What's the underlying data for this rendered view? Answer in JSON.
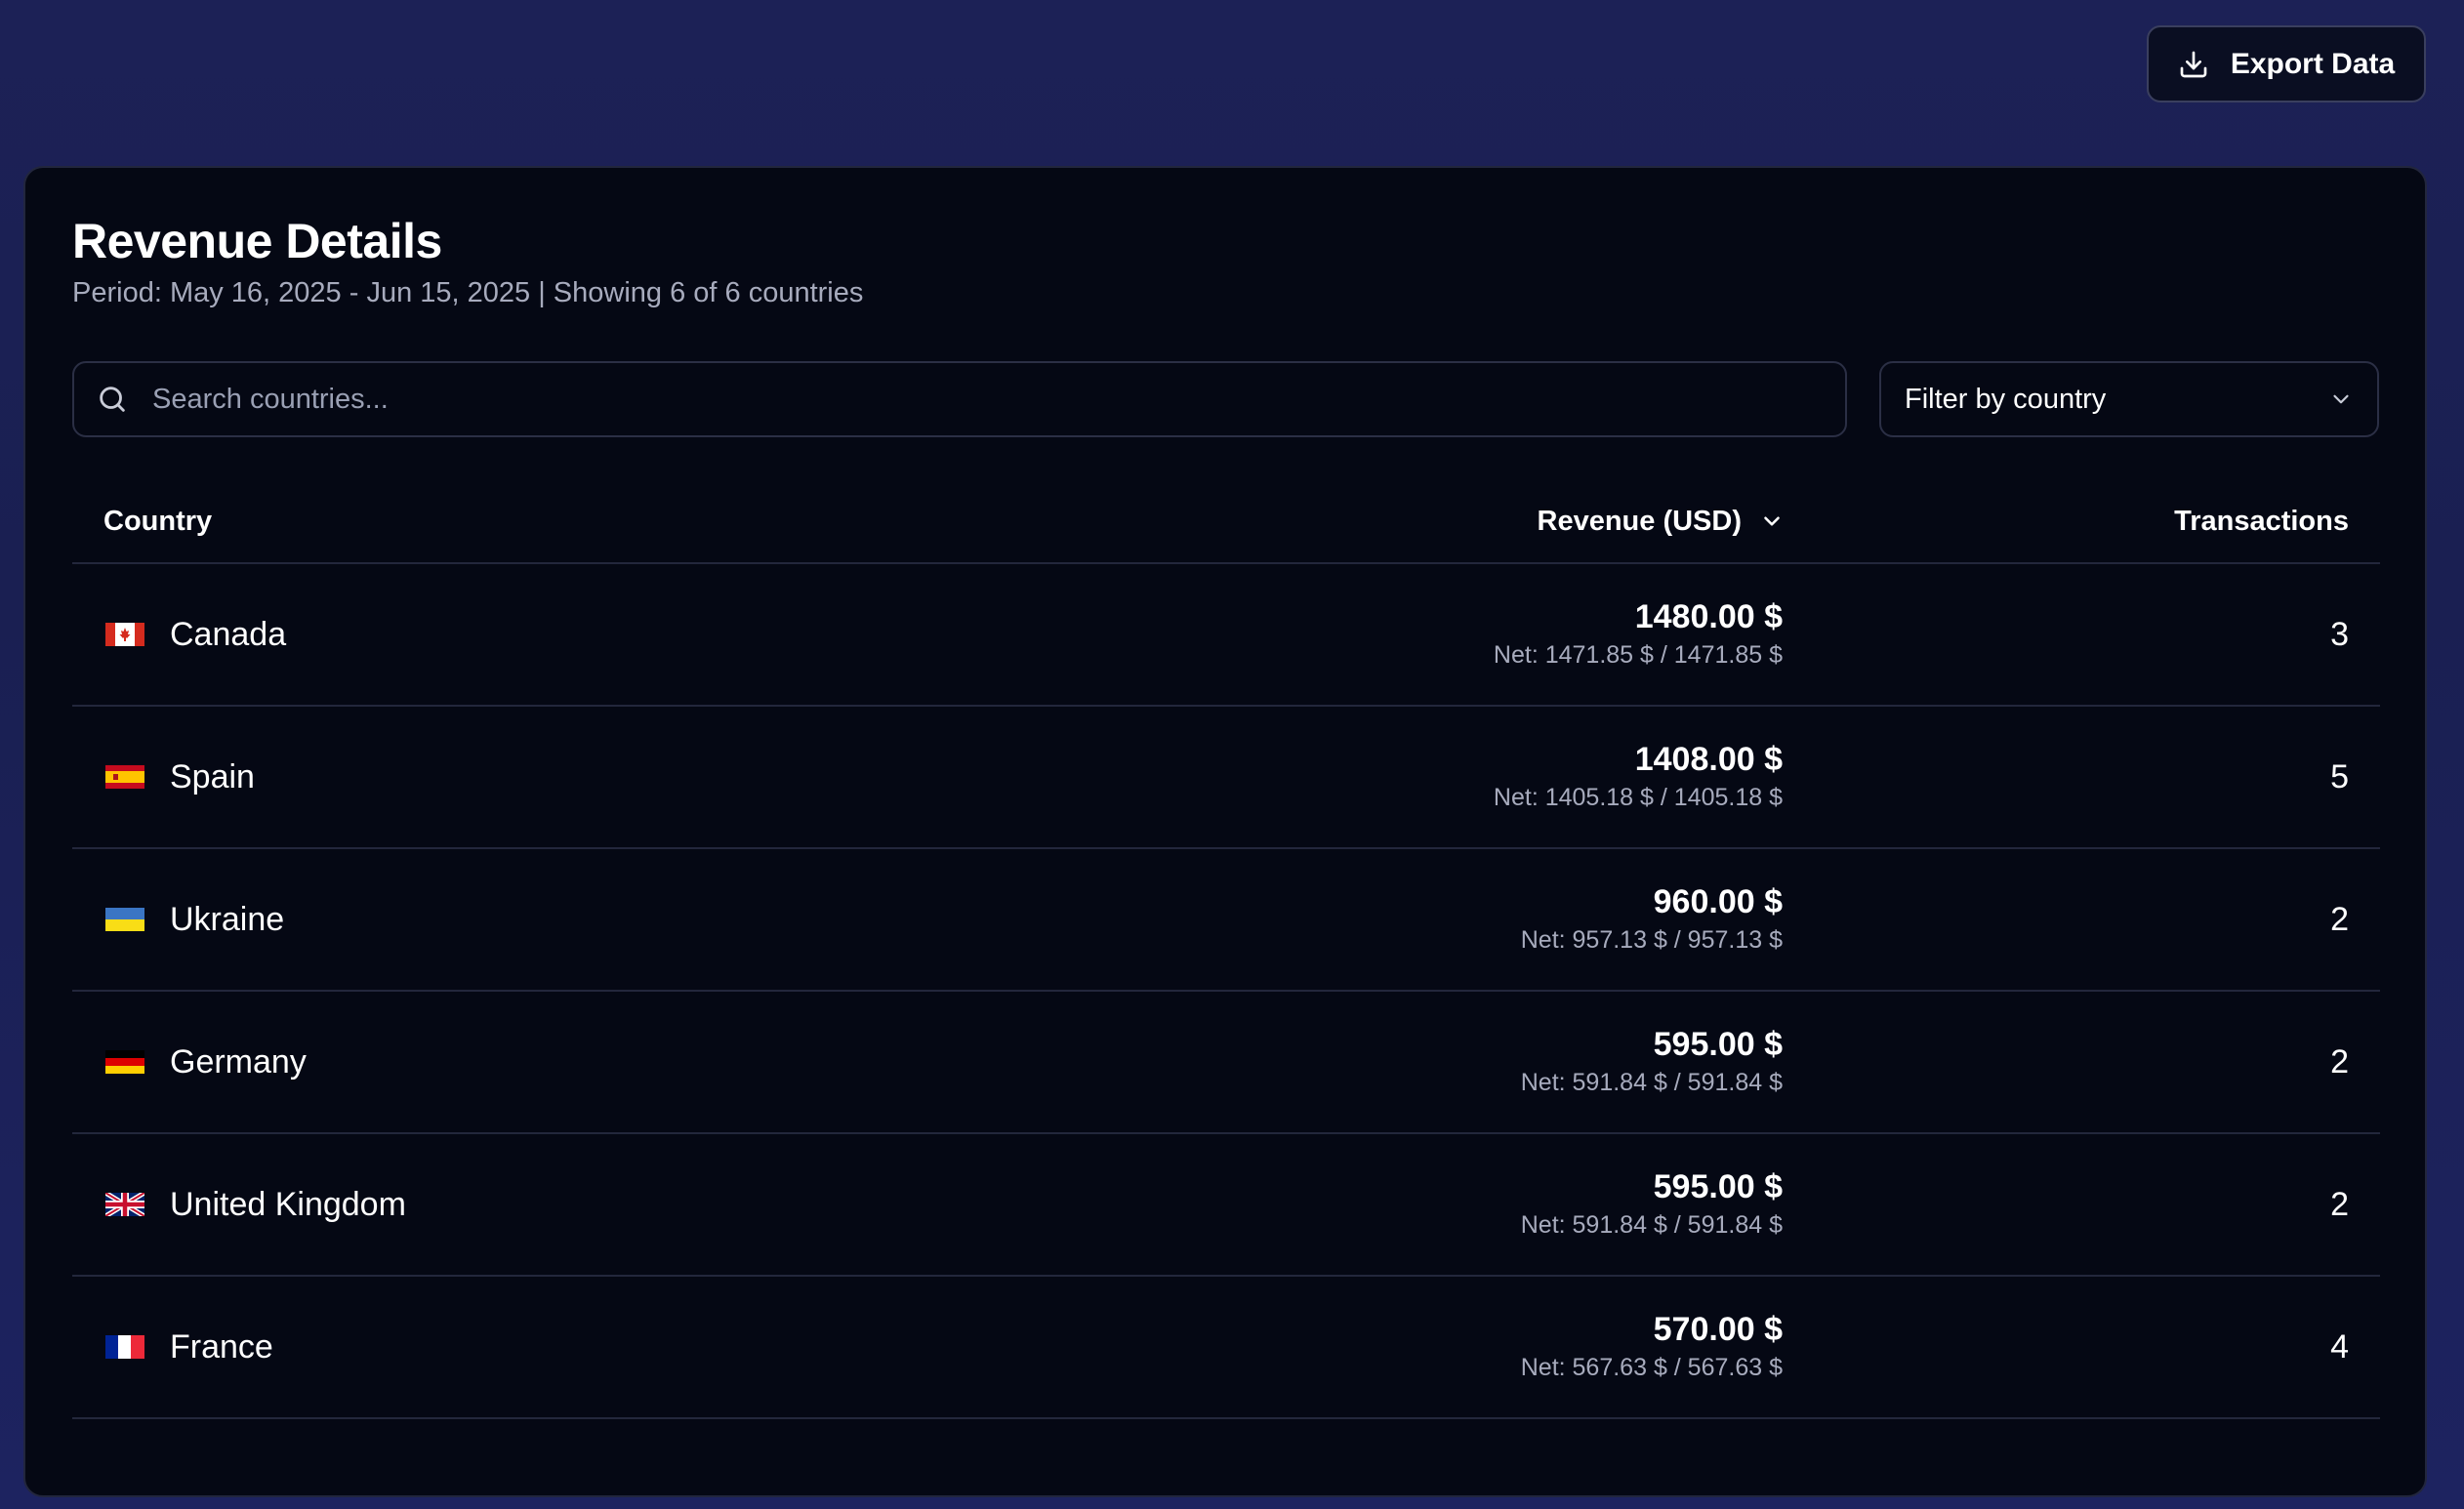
{
  "header": {
    "export_label": "Export Data"
  },
  "card": {
    "title": "Revenue Details",
    "subtitle": "Period: May 16, 2025 - Jun 15, 2025 | Showing 6 of 6 countries"
  },
  "search": {
    "placeholder": "Search countries..."
  },
  "filter": {
    "label": "Filter by country"
  },
  "table": {
    "columns": {
      "country": "Country",
      "revenue": "Revenue (USD)",
      "transactions": "Transactions"
    },
    "rows": [
      {
        "flag": "canada-flag-icon",
        "country": "Canada",
        "amount": "1480.00 $",
        "net": "Net: 1471.85 $ / 1471.85 $",
        "transactions": "3"
      },
      {
        "flag": "spain-flag-icon",
        "country": "Spain",
        "amount": "1408.00 $",
        "net": "Net: 1405.18 $ / 1405.18 $",
        "transactions": "5"
      },
      {
        "flag": "ukraine-flag-icon",
        "country": "Ukraine",
        "amount": "960.00 $",
        "net": "Net: 957.13 $ / 957.13 $",
        "transactions": "2"
      },
      {
        "flag": "germany-flag-icon",
        "country": "Germany",
        "amount": "595.00 $",
        "net": "Net: 591.84 $ / 591.84 $",
        "transactions": "2"
      },
      {
        "flag": "uk-flag-icon",
        "country": "United Kingdom",
        "amount": "595.00 $",
        "net": "Net: 591.84 $ / 591.84 $",
        "transactions": "2"
      },
      {
        "flag": "france-flag-icon",
        "country": "France",
        "amount": "570.00 $",
        "net": "Net: 567.63 $ / 567.63 $",
        "transactions": "4"
      }
    ]
  }
}
